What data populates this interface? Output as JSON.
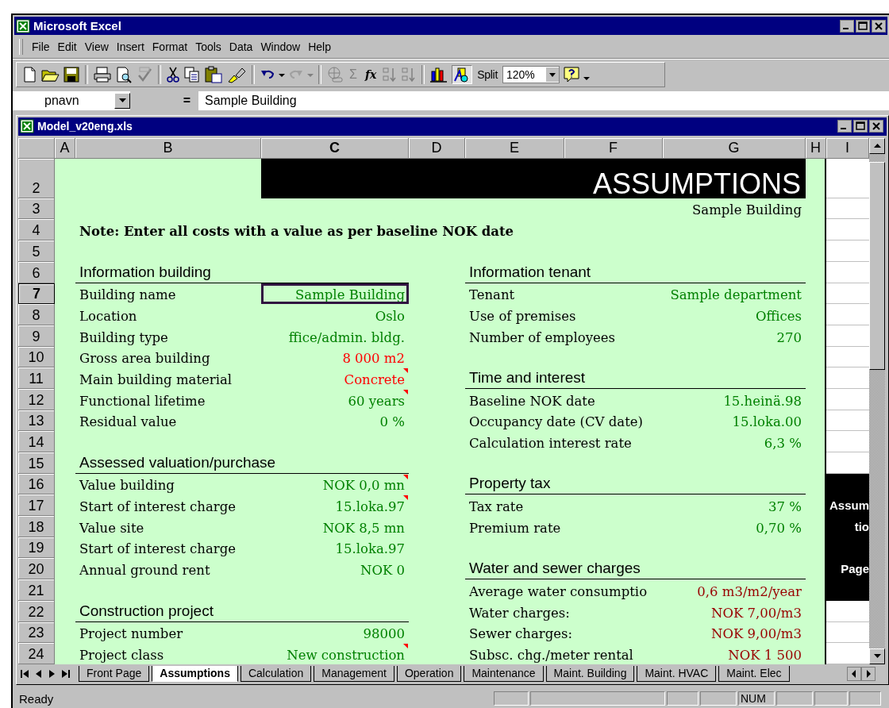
{
  "app": {
    "title": "Microsoft Excel"
  },
  "menu": [
    "File",
    "Edit",
    "View",
    "Insert",
    "Format",
    "Tools",
    "Data",
    "Window",
    "Help"
  ],
  "toolbar": {
    "sum_label": "Σ",
    "function_label": "fx",
    "split_label": "Split",
    "zoom": "120%"
  },
  "formula_bar": {
    "name_box": "pnavn",
    "equals": "=",
    "formula": "Sample Building"
  },
  "workbook": {
    "title": "Model_v20eng.xls"
  },
  "columns": [
    {
      "label": "A",
      "selected": false
    },
    {
      "label": "B",
      "selected": false
    },
    {
      "label": "C",
      "selected": true
    },
    {
      "label": "D",
      "selected": false
    },
    {
      "label": "E",
      "selected": false
    },
    {
      "label": "F",
      "selected": false
    },
    {
      "label": "G",
      "selected": false
    },
    {
      "label": "H",
      "selected": false
    },
    {
      "label": "I",
      "selected": false
    }
  ],
  "rows": [
    {
      "number": "2",
      "selected": false,
      "cells": {
        "C": {
          "kind": "title",
          "text": "ASSUMPTIONS",
          "selected": false
        }
      }
    },
    {
      "number": "3",
      "selected": false,
      "cells": {
        "G": {
          "kind": "subtitle",
          "text": "Sample Building",
          "selected": false
        }
      }
    },
    {
      "number": "4",
      "selected": false,
      "cells": {
        "B": {
          "kind": "note",
          "text": "Note: Enter all costs with a value as per baseline NOK date",
          "selected": false
        }
      }
    },
    {
      "number": "5",
      "selected": false,
      "cells": {}
    },
    {
      "number": "6",
      "selected": false,
      "cells": {
        "B": {
          "kind": "heading",
          "text": "Information building",
          "selected": false
        },
        "E": {
          "kind": "heading",
          "text": "Information tenant",
          "selected": false
        }
      }
    },
    {
      "number": "7",
      "selected": true,
      "cells": {
        "B": {
          "kind": "label",
          "text": "Building name",
          "selected": false
        },
        "C": {
          "kind": "value",
          "text": "Sample Building",
          "color": "#008000",
          "comment": false,
          "selected": true
        },
        "E": {
          "kind": "label",
          "text": "Tenant",
          "selected": false
        },
        "G": {
          "kind": "value",
          "text": "Sample department",
          "color": "#008000",
          "comment": false,
          "selected": false
        }
      }
    },
    {
      "number": "8",
      "selected": false,
      "cells": {
        "B": {
          "kind": "label",
          "text": "Location",
          "selected": false
        },
        "C": {
          "kind": "value",
          "text": "Oslo",
          "color": "#008000",
          "comment": false,
          "selected": false
        },
        "E": {
          "kind": "label",
          "text": "Use of premises",
          "selected": false
        },
        "G": {
          "kind": "value",
          "text": "Offices",
          "color": "#008000",
          "comment": false,
          "selected": false
        }
      }
    },
    {
      "number": "9",
      "selected": false,
      "cells": {
        "B": {
          "kind": "label",
          "text": "Building type",
          "selected": false
        },
        "C": {
          "kind": "value",
          "text": "ffice/admin. bldg.",
          "color": "#008000",
          "comment": false,
          "selected": false
        },
        "E": {
          "kind": "label",
          "text": "Number of employees",
          "selected": false
        },
        "G": {
          "kind": "value",
          "text": "270",
          "color": "#008000",
          "comment": false,
          "selected": false
        }
      }
    },
    {
      "number": "10",
      "selected": false,
      "cells": {
        "B": {
          "kind": "label",
          "text": "Gross area building",
          "selected": false
        },
        "C": {
          "kind": "value",
          "text": "8 000 m2",
          "color": "#ff0000",
          "comment": false,
          "selected": false
        }
      }
    },
    {
      "number": "11",
      "selected": false,
      "cells": {
        "B": {
          "kind": "label",
          "text": "Main building material",
          "selected": false
        },
        "C": {
          "kind": "value",
          "text": "Concrete",
          "color": "#ff0000",
          "comment": true,
          "selected": false
        },
        "E": {
          "kind": "heading",
          "text": "Time and interest",
          "selected": false
        }
      }
    },
    {
      "number": "12",
      "selected": false,
      "cells": {
        "B": {
          "kind": "label",
          "text": "Functional lifetime",
          "selected": false
        },
        "C": {
          "kind": "value",
          "text": "60 years",
          "color": "#008000",
          "comment": true,
          "selected": false
        },
        "E": {
          "kind": "label",
          "text": "Baseline NOK date",
          "selected": false
        },
        "G": {
          "kind": "value",
          "text": "15.heinä.98",
          "color": "#008000",
          "comment": false,
          "selected": false
        }
      }
    },
    {
      "number": "13",
      "selected": false,
      "cells": {
        "B": {
          "kind": "label",
          "text": "Residual value",
          "selected": false
        },
        "C": {
          "kind": "value",
          "text": "0 %",
          "color": "#008000",
          "comment": false,
          "selected": false
        },
        "E": {
          "kind": "label",
          "text": "Occupancy date (CV date)",
          "selected": false
        },
        "G": {
          "kind": "value",
          "text": "15.loka.00",
          "color": "#008000",
          "comment": false,
          "selected": false
        }
      }
    },
    {
      "number": "14",
      "selected": false,
      "cells": {
        "E": {
          "kind": "label",
          "text": "Calculation interest rate",
          "selected": false
        },
        "G": {
          "kind": "value",
          "text": "6,3 %",
          "color": "#008000",
          "comment": false,
          "selected": false
        }
      }
    },
    {
      "number": "15",
      "selected": false,
      "cells": {
        "B": {
          "kind": "heading",
          "text": "Assessed valuation/purchase",
          "selected": false
        }
      }
    },
    {
      "number": "16",
      "selected": false,
      "cells": {
        "B": {
          "kind": "label",
          "text": "Value building",
          "selected": false
        },
        "C": {
          "kind": "value",
          "text": "NOK 0,0 mn",
          "color": "#008000",
          "comment": true,
          "selected": false
        },
        "E": {
          "kind": "heading",
          "text": "Property tax",
          "selected": false
        }
      }
    },
    {
      "number": "17",
      "selected": false,
      "cells": {
        "B": {
          "kind": "label",
          "text": "Start of interest charge",
          "selected": false
        },
        "C": {
          "kind": "value",
          "text": "15.loka.97",
          "color": "#008000",
          "comment": true,
          "selected": false
        },
        "E": {
          "kind": "label",
          "text": "Tax rate",
          "selected": false
        },
        "G": {
          "kind": "value",
          "text": "37 %",
          "color": "#008000",
          "comment": false,
          "selected": false
        }
      }
    },
    {
      "number": "18",
      "selected": false,
      "cells": {
        "B": {
          "kind": "label",
          "text": "Value site",
          "selected": false
        },
        "C": {
          "kind": "value",
          "text": "NOK 8,5 mn",
          "color": "#008000",
          "comment": false,
          "selected": false
        },
        "E": {
          "kind": "label",
          "text": "Premium rate",
          "selected": false
        },
        "G": {
          "kind": "value",
          "text": "0,70 %",
          "color": "#008000",
          "comment": false,
          "selected": false
        }
      }
    },
    {
      "number": "19",
      "selected": false,
      "cells": {
        "B": {
          "kind": "label",
          "text": "Start of interest charge",
          "selected": false
        },
        "C": {
          "kind": "value",
          "text": "15.loka.97",
          "color": "#008000",
          "comment": false,
          "selected": false
        }
      }
    },
    {
      "number": "20",
      "selected": false,
      "cells": {
        "B": {
          "kind": "label",
          "text": "Annual ground rent",
          "selected": false
        },
        "C": {
          "kind": "value",
          "text": "NOK 0",
          "color": "#008000",
          "comment": false,
          "selected": false
        },
        "E": {
          "kind": "heading",
          "text": "Water and sewer charges",
          "selected": false
        }
      }
    },
    {
      "number": "21",
      "selected": false,
      "cells": {
        "E": {
          "kind": "label",
          "text": "Average water consumptio",
          "selected": false
        },
        "G": {
          "kind": "value",
          "text": "0,6 m3/m2/year",
          "color": "#990000",
          "comment": false,
          "selected": false
        }
      }
    },
    {
      "number": "22",
      "selected": false,
      "cells": {
        "B": {
          "kind": "heading",
          "text": "Construction project",
          "selected": false
        },
        "E": {
          "kind": "label",
          "text": "Water charges:",
          "selected": false
        },
        "G": {
          "kind": "value",
          "text": "NOK 7,00/m3",
          "color": "#990000",
          "comment": false,
          "selected": false
        }
      }
    },
    {
      "number": "23",
      "selected": false,
      "cells": {
        "B": {
          "kind": "label",
          "text": "Project number",
          "selected": false
        },
        "C": {
          "kind": "value",
          "text": "98000",
          "color": "#008000",
          "comment": false,
          "selected": false
        },
        "E": {
          "kind": "label",
          "text": "Sewer charges:",
          "selected": false
        },
        "G": {
          "kind": "value",
          "text": "NOK 9,00/m3",
          "color": "#990000",
          "comment": false,
          "selected": false
        }
      }
    },
    {
      "number": "24",
      "selected": false,
      "cells": {
        "B": {
          "kind": "label",
          "text": "Project class",
          "selected": false
        },
        "C": {
          "kind": "value",
          "text": "New construction",
          "color": "#008000",
          "comment": true,
          "selected": false
        },
        "E": {
          "kind": "label",
          "text": "Subsc. chg./meter rental",
          "selected": false
        },
        "G": {
          "kind": "value",
          "text": "NOK 1 500",
          "color": "#990000",
          "comment": false,
          "selected": false
        }
      }
    }
  ],
  "side_panel": {
    "lines": [
      "Assum",
      "tio",
      "Page"
    ]
  },
  "sheet_tabs": [
    {
      "label": "Front Page",
      "selected": false
    },
    {
      "label": "Assumptions",
      "selected": true
    },
    {
      "label": "Calculation",
      "selected": false
    },
    {
      "label": "Management",
      "selected": false
    },
    {
      "label": "Operation",
      "selected": false
    },
    {
      "label": "Maintenance",
      "selected": false
    },
    {
      "label": "Maint. Building",
      "selected": false
    },
    {
      "label": "Maint. HVAC",
      "selected": false
    },
    {
      "label": "Maint. Elec",
      "selected": false
    }
  ],
  "status_bar": {
    "message": "Ready",
    "indicator": "NUM"
  }
}
